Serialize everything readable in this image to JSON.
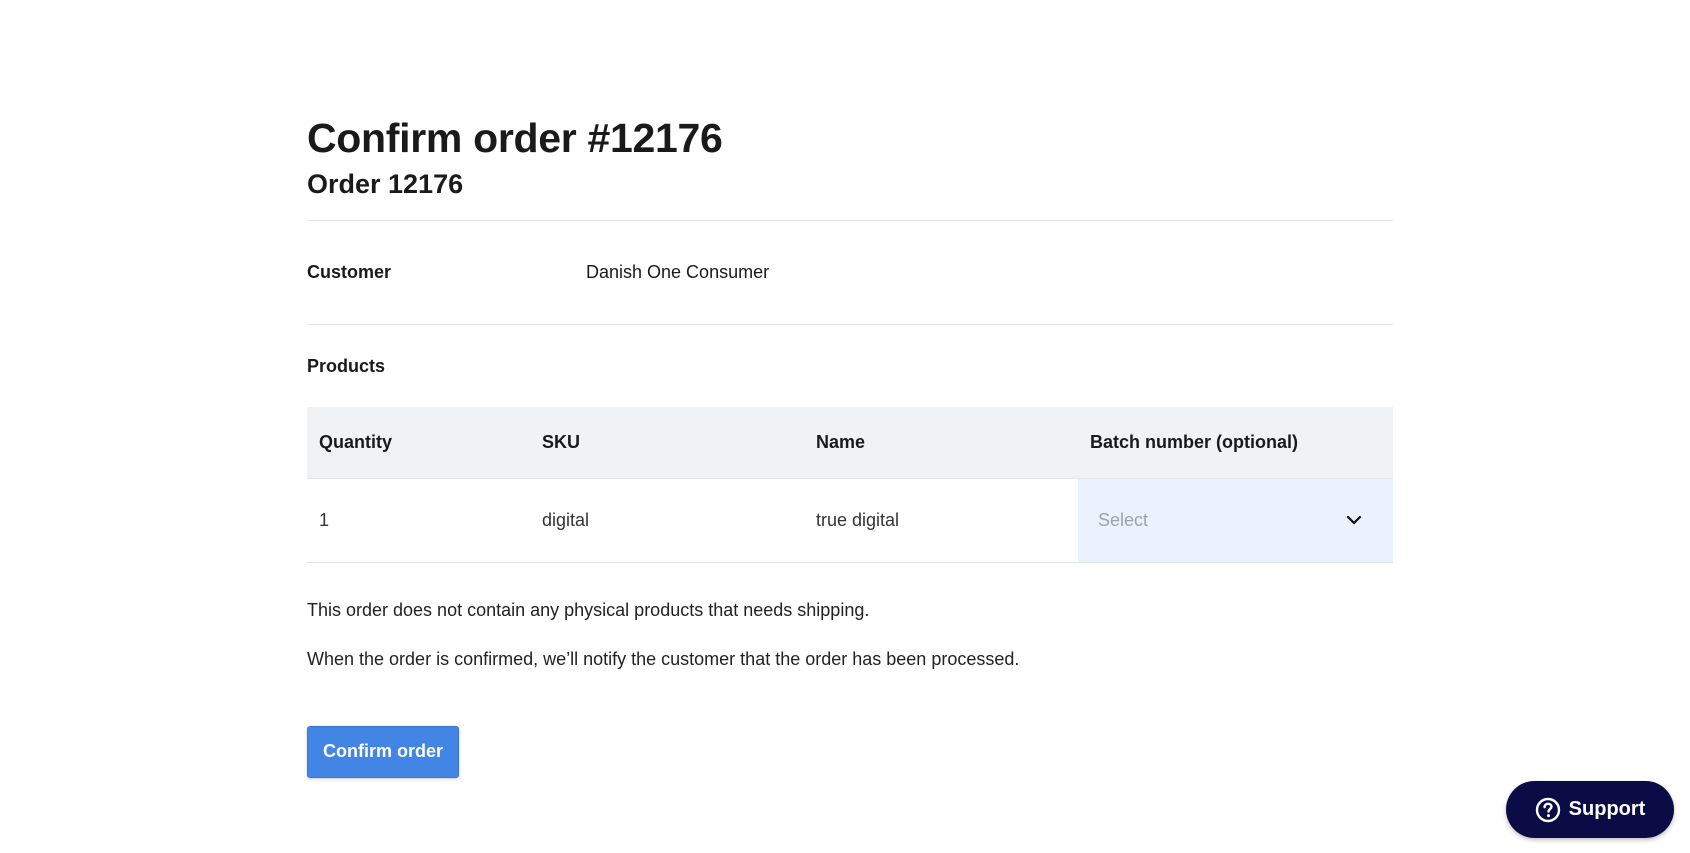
{
  "header": {
    "title": "Confirm order #12176",
    "subtitle": "Order 12176"
  },
  "customer": {
    "label": "Customer",
    "value": "Danish One Consumer"
  },
  "products": {
    "label": "Products",
    "columns": [
      "Quantity",
      "SKU",
      "Name",
      "Batch number (optional)"
    ],
    "rows": [
      {
        "quantity": "1",
        "sku": "digital",
        "name": "true digital",
        "batch_placeholder": "Select"
      }
    ]
  },
  "notices": {
    "shipping": "This order does not contain any physical products that needs shipping.",
    "notification": "When the order is confirmed, we’ll notify the customer that the order has been processed."
  },
  "actions": {
    "confirm_label": "Confirm order"
  },
  "support": {
    "label": "Support",
    "icon": "help-circle-icon"
  },
  "colors": {
    "primary": "#4285e4",
    "support_bg": "#0b0c45",
    "table_header_bg": "#f1f2f4",
    "select_bg": "#ebf2fd"
  }
}
